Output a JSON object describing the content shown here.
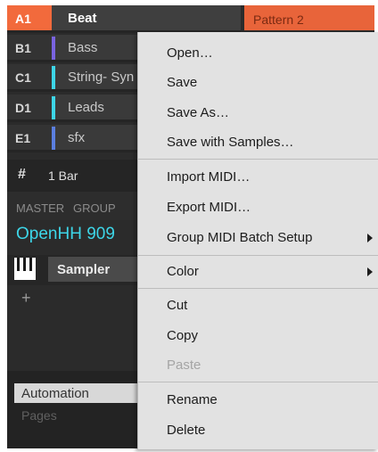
{
  "groups": [
    {
      "id": "A1",
      "name": "Beat",
      "color": "#f26a3c"
    },
    {
      "id": "B1",
      "name": "Bass",
      "color": "#7a63e0"
    },
    {
      "id": "C1",
      "name": "String- Syn",
      "color": "#3dd6e8"
    },
    {
      "id": "D1",
      "name": "Leads",
      "color": "#3dd6e8"
    },
    {
      "id": "E1",
      "name": "sfx",
      "color": "#5b7fe0"
    }
  ],
  "pattern": {
    "name": "Pattern 2"
  },
  "bar": {
    "icon": "grid-icon",
    "label": "1 Bar"
  },
  "tabs": [
    "MASTER",
    "GROUP"
  ],
  "sound": {
    "name": "OpenHH 909"
  },
  "plugin": {
    "name": "Sampler",
    "icon": "keyboard-icon",
    "add": "+"
  },
  "automation": {
    "label": "Automation",
    "pages_label": "Pages"
  },
  "context_menu": {
    "items": [
      {
        "label": "Open…",
        "disabled": false,
        "submenu": false
      },
      {
        "label": "Save",
        "disabled": false,
        "submenu": false
      },
      {
        "label": "Save As…",
        "disabled": false,
        "submenu": false
      },
      {
        "label": "Save with Samples…",
        "disabled": false,
        "submenu": false
      },
      {
        "label": "Import MIDI…",
        "disabled": false,
        "submenu": false
      },
      {
        "label": "Export MIDI…",
        "disabled": false,
        "submenu": false
      },
      {
        "label": "Group MIDI Batch Setup",
        "disabled": false,
        "submenu": true
      },
      {
        "label": "Color",
        "disabled": false,
        "submenu": true
      },
      {
        "label": "Cut",
        "disabled": false,
        "submenu": false
      },
      {
        "label": "Copy",
        "disabled": false,
        "submenu": false
      },
      {
        "label": "Paste",
        "disabled": true,
        "submenu": false
      },
      {
        "label": "Rename",
        "disabled": false,
        "submenu": false
      },
      {
        "label": "Delete",
        "disabled": false,
        "submenu": false
      }
    ]
  },
  "colors": {
    "accent": "#f26a3c",
    "sound_name": "#3dd6e8"
  }
}
